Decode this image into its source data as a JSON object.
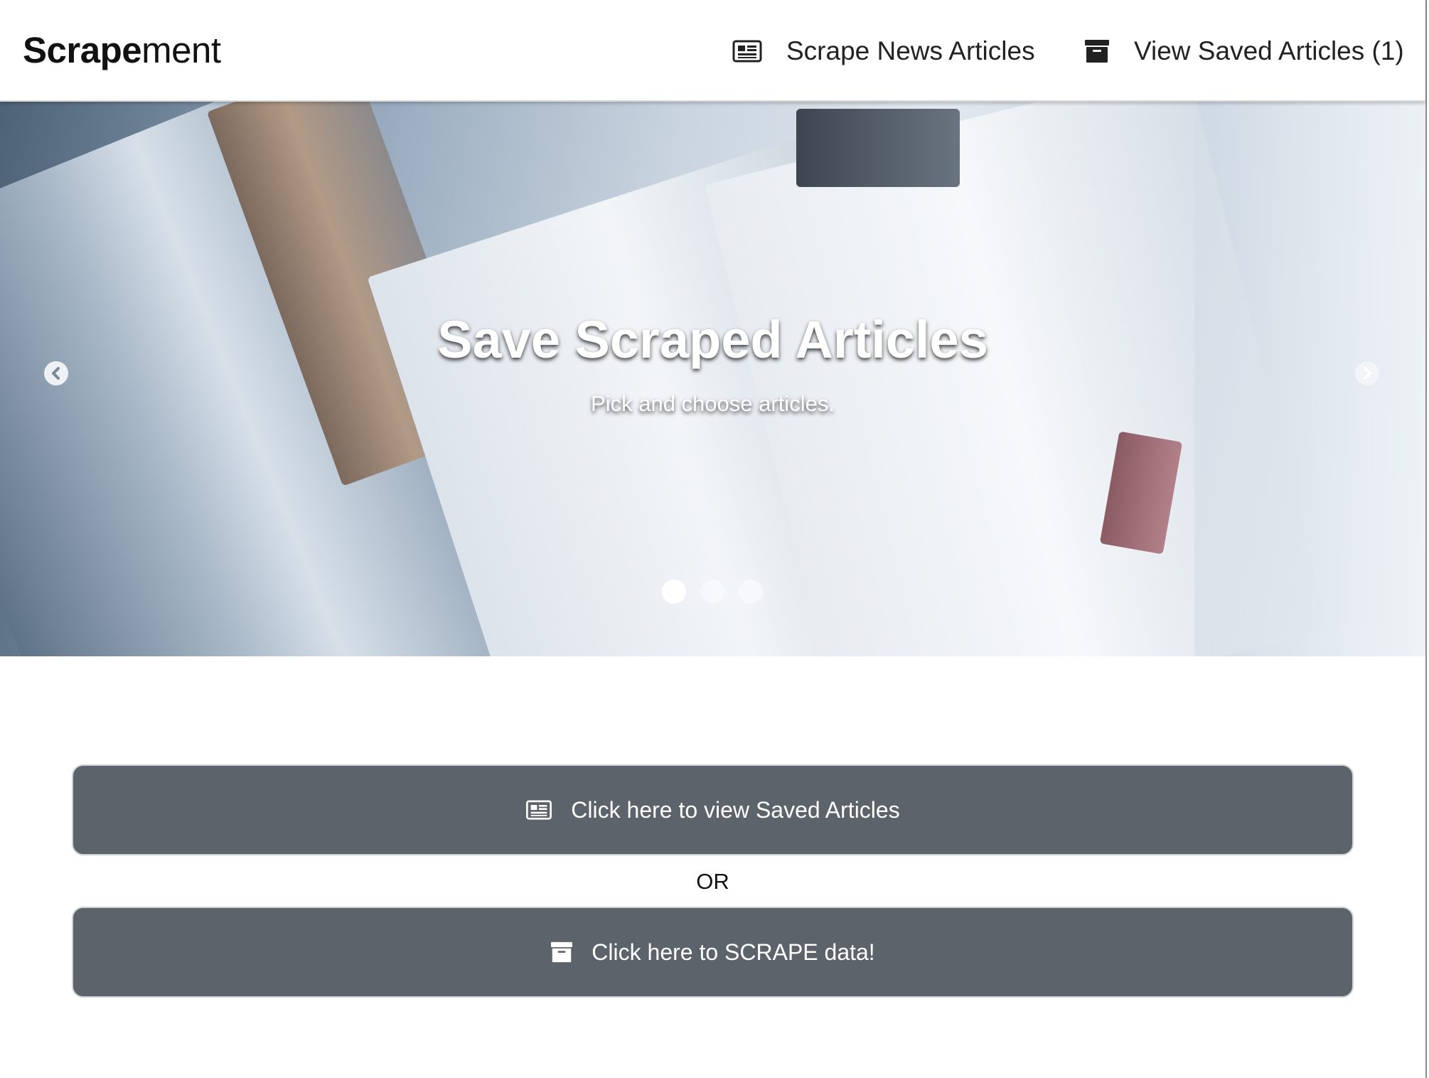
{
  "navbar": {
    "brand_bold": "Scrape",
    "brand_light": "ment",
    "scrape_link": "Scrape News Articles",
    "saved_link": "View Saved Articles (1)"
  },
  "carousel": {
    "title": "Save Scraped Articles",
    "subtitle": "Pick and choose articles.",
    "slide_count": 3,
    "active_slide": 1,
    "icons": {
      "prev": "chevron-left-icon",
      "next": "chevron-right-icon"
    }
  },
  "main": {
    "view_button": "Click here to view Saved Articles",
    "or_text": "OR",
    "scrape_button": "Click here to SCRAPE data!"
  },
  "icons": {
    "newspaper": "newspaper-icon",
    "archive": "archive-box-icon"
  },
  "colors": {
    "button_bg": "#5c636a",
    "navbar_bg": "#ffffff",
    "text": "#222222"
  }
}
